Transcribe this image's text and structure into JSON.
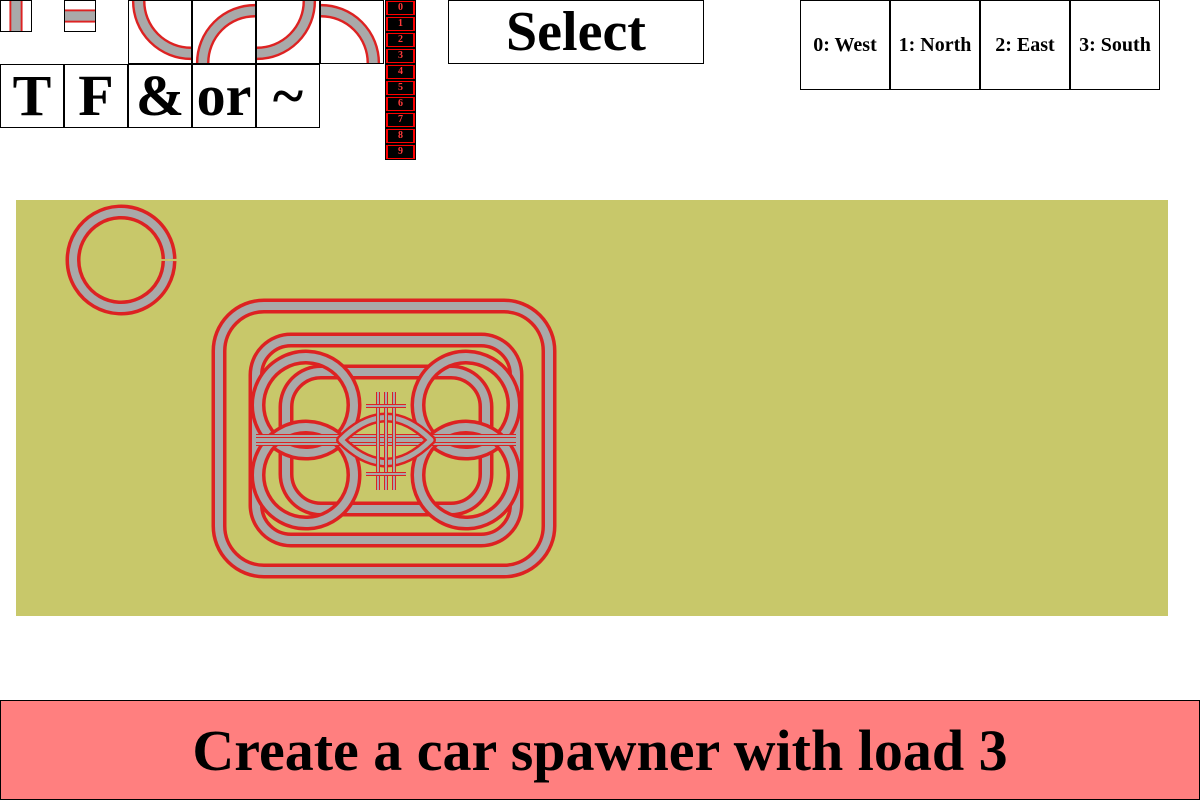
{
  "palette": {
    "board": "#c8c86a",
    "track_rail": "#dd2222",
    "track_bed": "#a9a9a9",
    "number_tile": "#ff0000",
    "banner": "#ff7f7f"
  },
  "track_toolbar": {
    "tiles": [
      {
        "icon": "vertical-straight-track-icon"
      },
      {
        "icon": "horizontal-straight-track-icon"
      },
      {
        "icon": "curve-track-north-east-icon"
      },
      {
        "icon": "curve-track-south-east-icon"
      },
      {
        "icon": "curve-track-north-west-icon"
      },
      {
        "icon": "curve-track-south-west-icon"
      }
    ]
  },
  "logic_toolbar": {
    "tiles": [
      {
        "label": "T"
      },
      {
        "label": "F"
      },
      {
        "label": "&"
      },
      {
        "label": "or"
      },
      {
        "label": "~"
      }
    ]
  },
  "number_column": {
    "items": [
      "0",
      "1",
      "2",
      "3",
      "4",
      "5",
      "6",
      "7",
      "8",
      "9"
    ]
  },
  "select_button": {
    "label": "Select"
  },
  "direction_buttons": [
    {
      "label": "0: West"
    },
    {
      "label": "1: North"
    },
    {
      "label": "2: East"
    },
    {
      "label": "3: South"
    }
  ],
  "board": {
    "icon": "railway-track-layout"
  },
  "instruction": {
    "text": "Create a car spawner with load 3"
  }
}
